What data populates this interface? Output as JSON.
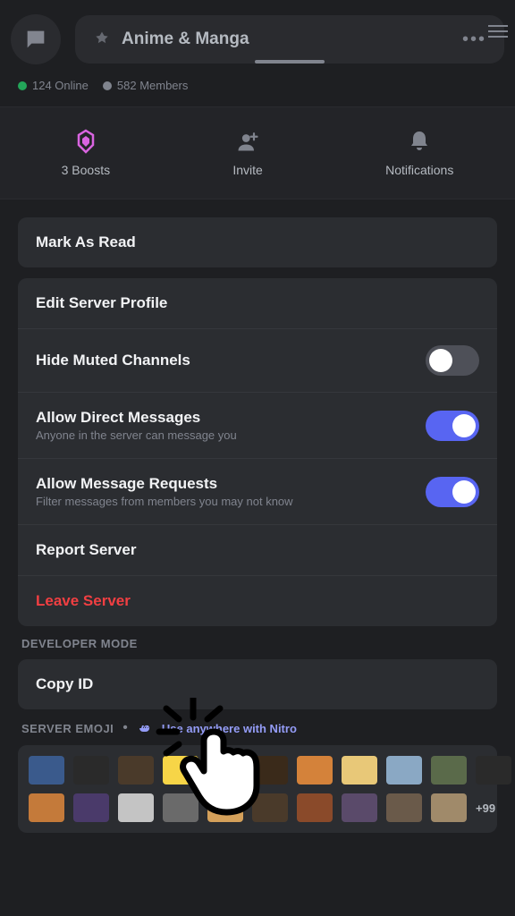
{
  "header": {
    "server_name": "Anime & Manga"
  },
  "stats": {
    "online_count": "124 Online",
    "member_count": "582 Members"
  },
  "actions": {
    "boosts_label": "3 Boosts",
    "invite_label": "Invite",
    "notifications_label": "Notifications"
  },
  "settings": {
    "mark_as_read": "Mark As Read",
    "edit_profile": "Edit Server Profile",
    "hide_muted": {
      "title": "Hide Muted Channels",
      "value": false
    },
    "allow_dm": {
      "title": "Allow Direct Messages",
      "subtitle": "Anyone in the server can message you",
      "value": true
    },
    "allow_requests": {
      "title": "Allow Message Requests",
      "subtitle": "Filter messages from members you may not know",
      "value": true
    },
    "report": "Report Server",
    "leave": "Leave Server"
  },
  "developer": {
    "header": "Developer Mode",
    "copy_id": "Copy ID"
  },
  "emoji": {
    "header": "Server Emoji",
    "nitro_text": "Use anywhere with Nitro",
    "more_count": "+99",
    "row1_colors": [
      "#3a5a8c",
      "#2a2a2a",
      "#4a3a2a",
      "#f7d547",
      "#f0b3d4",
      "#3a2a1a",
      "#d4823a",
      "#e8c878",
      "#8aa8c4",
      "#5a6a4a",
      "#2a2a2a"
    ],
    "row2_colors": [
      "#c47a3a",
      "#4a3a6a",
      "#c4c4c4",
      "#6a6a6a",
      "#d4a05a",
      "#4a3a2a",
      "#8a4a2a",
      "#5a4a6a",
      "#6a5a4a",
      "#a08a6a"
    ]
  }
}
